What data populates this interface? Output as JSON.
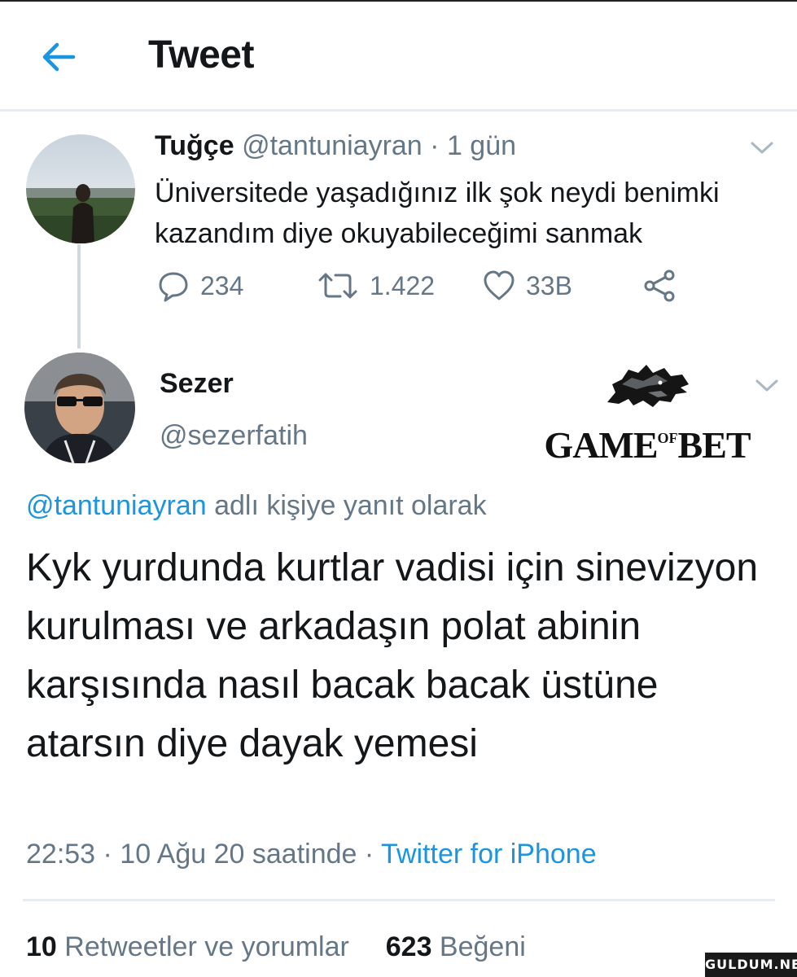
{
  "header": {
    "title": "Tweet"
  },
  "icons": {
    "back": "arrow-left-icon",
    "caret": "chevron-down-icon",
    "reply": "comment-icon",
    "retweet": "retweet-icon",
    "like": "heart-icon",
    "share": "share-icon"
  },
  "colors": {
    "accent": "#1b95e0",
    "muted": "#657786",
    "text": "#14171a",
    "divider": "#e6ecf0"
  },
  "parent_tweet": {
    "name": "Tuğçe",
    "handle": "@tantuniayran",
    "time": "· 1 gün",
    "text": "Üniversitede yaşadığınız ilk şok neydi benimki kazandım diye okuyabileceğimi sanmak",
    "replies": "234",
    "retweets": "1.422",
    "likes": "33B"
  },
  "main_tweet": {
    "name": "Sezer",
    "handle": "@sezerfatih",
    "reply_to_handle": "@tantuniayran",
    "reply_to_suffix": " adlı kişiye yanıt olarak",
    "text": "Kyk yurdunda kurtlar vadisi için sinevizyon kurulması ve arkadaşın polat abinin karşısında nasıl bacak bacak üstüne atarsın diye dayak yemesi",
    "time": "22:53 · 10 Ağu 20 saatinde · ",
    "source": "Twitter for iPhone",
    "retweet_count": "10",
    "retweet_label": " Retweetler ve yorumlar",
    "like_count": "623",
    "like_label": " Beğeni"
  },
  "overlay_logo": {
    "text_left": "GAME",
    "text_small": "OF",
    "text_right": "BET",
    "icon": "wolf-head-icon"
  },
  "watermark": {
    "text": "GULDUM.NET"
  }
}
